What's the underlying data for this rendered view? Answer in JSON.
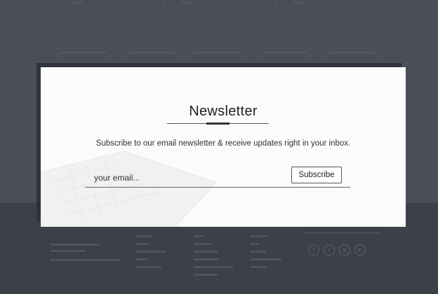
{
  "modal": {
    "title": "Newsletter",
    "description": "Subscribe to our email newsletter & receive updates right in your inbox.",
    "email_placeholder": "your email...",
    "subscribe_label": "Subscribe"
  },
  "footer": {
    "social": [
      {
        "icon": "facebook-icon",
        "glyph": "f"
      },
      {
        "icon": "twitter-icon",
        "glyph": "t"
      },
      {
        "icon": "instagram-icon",
        "glyph": "◎"
      },
      {
        "icon": "linkedin-icon",
        "glyph": "in"
      }
    ]
  },
  "colors": {
    "overlay": "#4a4f57",
    "modal_bg": "#fbfbfb",
    "text": "#222222"
  }
}
